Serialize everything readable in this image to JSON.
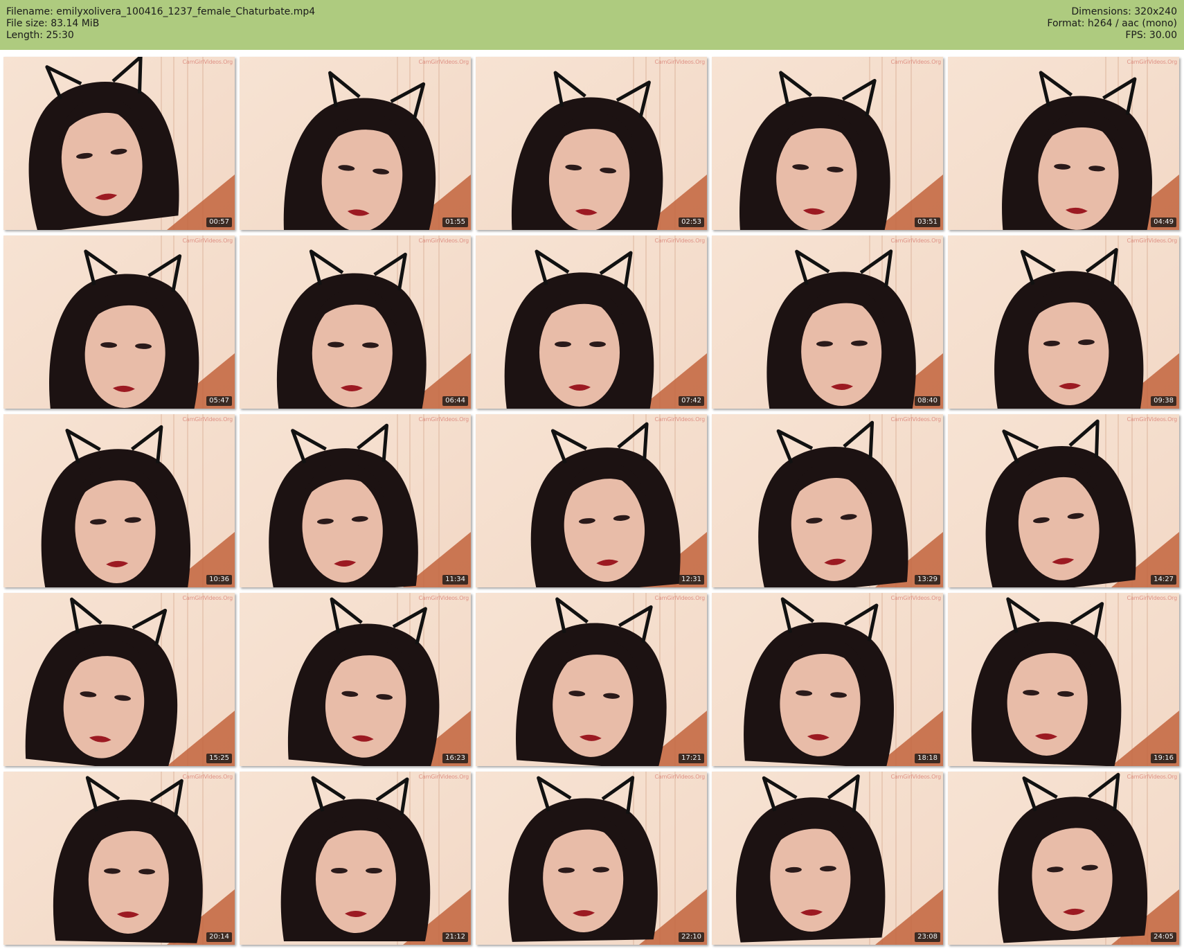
{
  "header": {
    "filename": "Filename: emilyxolivera_100416_1237_female_Chaturbate.mp4",
    "filesize": "File size: 83.14 MiB",
    "length": "Length: 25:30",
    "dimensions": "Dimensions: 320x240",
    "format": "Format: h264 / aac (mono)",
    "fps": "FPS: 30.00"
  },
  "colors": {
    "header_bg": "#aecb7f",
    "wall": "#f2d8c6",
    "door": "#c2643d",
    "hair": "#1c1212",
    "skin": "#e8bca8",
    "lips": "#9c1a22"
  },
  "watermark": "CamGirlVideos.Org",
  "thumbnails": [
    {
      "timestamp": "00:57"
    },
    {
      "timestamp": "01:55"
    },
    {
      "timestamp": "02:53"
    },
    {
      "timestamp": "03:51"
    },
    {
      "timestamp": "04:49"
    },
    {
      "timestamp": "05:47"
    },
    {
      "timestamp": "06:44"
    },
    {
      "timestamp": "07:42"
    },
    {
      "timestamp": "08:40"
    },
    {
      "timestamp": "09:38"
    },
    {
      "timestamp": "10:36"
    },
    {
      "timestamp": "11:34"
    },
    {
      "timestamp": "12:31"
    },
    {
      "timestamp": "13:29"
    },
    {
      "timestamp": "14:27"
    },
    {
      "timestamp": "15:25"
    },
    {
      "timestamp": "16:23"
    },
    {
      "timestamp": "17:21"
    },
    {
      "timestamp": "18:18"
    },
    {
      "timestamp": "19:16"
    },
    {
      "timestamp": "20:14"
    },
    {
      "timestamp": "21:12"
    },
    {
      "timestamp": "22:10"
    },
    {
      "timestamp": "23:08"
    },
    {
      "timestamp": "24:05"
    }
  ]
}
